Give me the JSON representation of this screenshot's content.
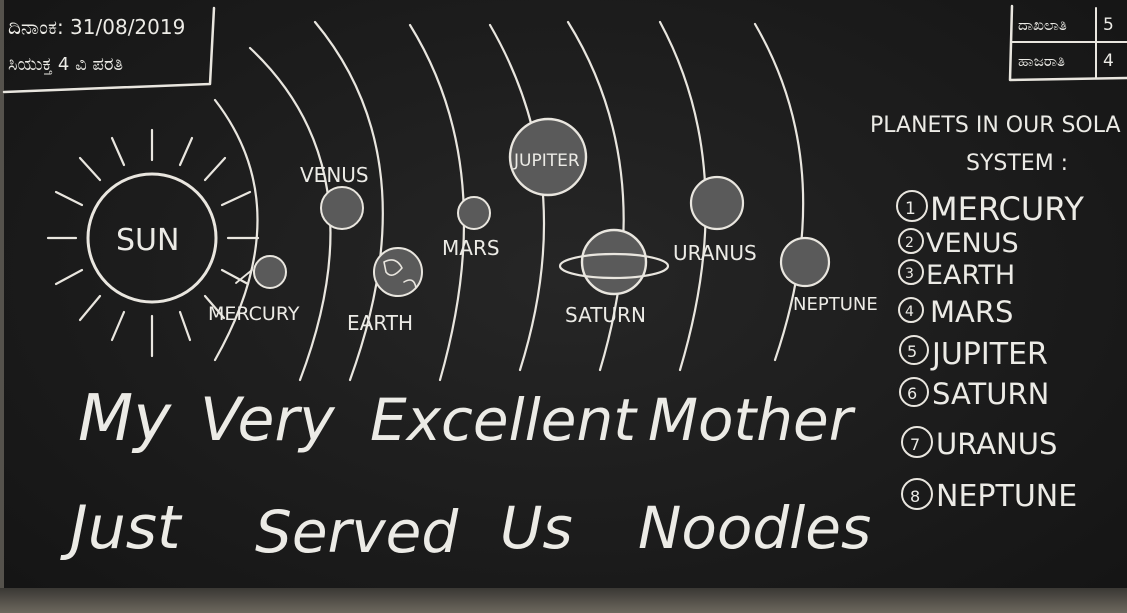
{
  "top_left_note": {
    "line1": "ದಿನಾಂಕ: 31/08/2019",
    "line2": "ಸಿಯುಕ್ತ 4 ವಿ ಪರತಿ"
  },
  "top_right_note": {
    "line1": "ದಾಖಲಾತಿ",
    "line1_value": "5",
    "line2": "ಹಾಜರಾತಿ",
    "line2_value": "4"
  },
  "diagram": {
    "sun": "SUN",
    "planets": [
      {
        "label": "MERCURY"
      },
      {
        "label": "VENUS"
      },
      {
        "label": "EARTH"
      },
      {
        "label": "MARS"
      },
      {
        "label": "JUPITER"
      },
      {
        "label": "SATURN"
      },
      {
        "label": "URANUS"
      },
      {
        "label": "NEPTUNE"
      }
    ]
  },
  "planet_list": {
    "title_line1": "PLANETS IN OUR SOLA",
    "title_line2": "SYSTEM :",
    "items": [
      {
        "num": "1",
        "name": "MERCURY"
      },
      {
        "num": "2",
        "name": "VENUS"
      },
      {
        "num": "3",
        "name": "EARTH"
      },
      {
        "num": "4",
        "name": "MARS"
      },
      {
        "num": "5",
        "name": "JUPITER"
      },
      {
        "num": "6",
        "name": "SATURN"
      },
      {
        "num": "7",
        "name": "URANUS"
      },
      {
        "num": "8",
        "name": "NEPTUNE"
      }
    ]
  },
  "mnemonic": {
    "line1": [
      "My",
      "Very",
      "Excellent",
      "Mother"
    ],
    "line2": [
      "Just",
      "Served",
      "Us",
      "Noodles"
    ]
  }
}
